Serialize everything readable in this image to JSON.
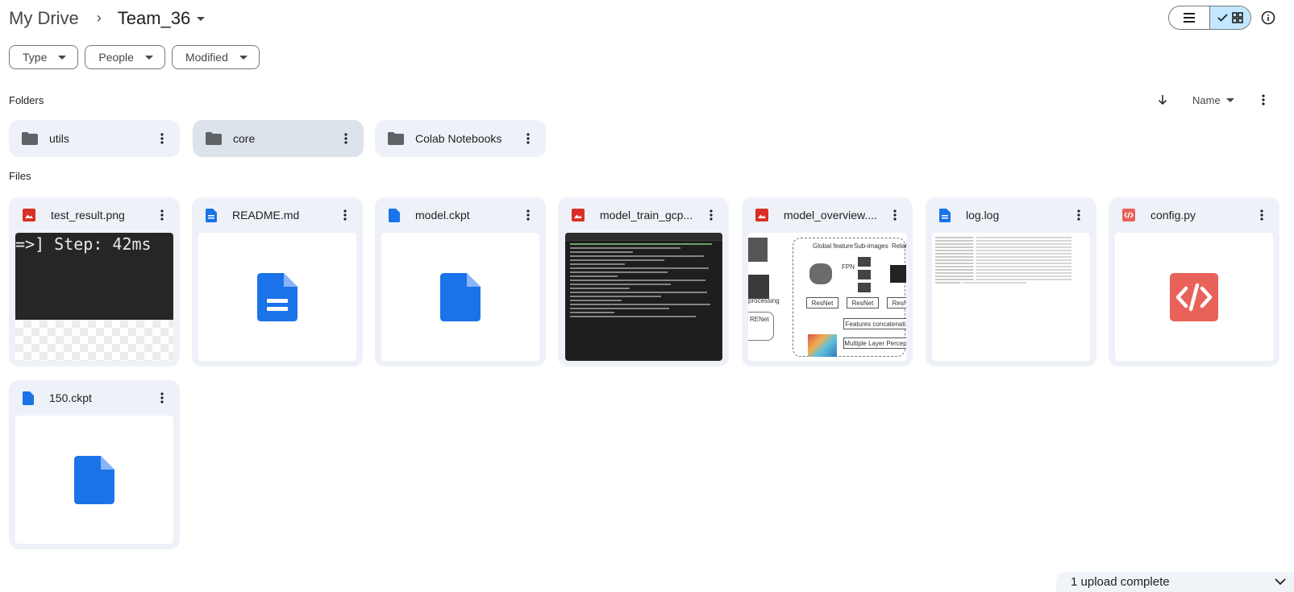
{
  "breadcrumb": {
    "root": "My Drive",
    "separator": "›",
    "current": "Team_36"
  },
  "view_toggle": {
    "list_icon": "list-icon",
    "grid_icon": "grid-icon",
    "active": "grid"
  },
  "filters": [
    {
      "label": "Type"
    },
    {
      "label": "People"
    },
    {
      "label": "Modified"
    }
  ],
  "folders_section": {
    "label": "Folders"
  },
  "files_section": {
    "label": "Files"
  },
  "sort": {
    "direction_icon": "arrow-down-icon",
    "field": "Name"
  },
  "folders": [
    {
      "name": "utils",
      "selected": false
    },
    {
      "name": "core",
      "selected": true
    },
    {
      "name": "Colab Notebooks",
      "selected": false
    }
  ],
  "files": [
    {
      "name": "test_result.png",
      "type": "image",
      "preview_text": "=>]  Step: 42ms"
    },
    {
      "name": "README.md",
      "type": "doc"
    },
    {
      "name": "model.ckpt",
      "type": "file"
    },
    {
      "name": "model_train_gcp...",
      "type": "image"
    },
    {
      "name": "model_overview....",
      "type": "image",
      "diagram_labels": [
        "Global feature",
        "Sub-images",
        "Relat feat",
        "FPN",
        "ResNet",
        "ResNet",
        "ResNet",
        "Res",
        "processing",
        "RENet",
        "Features concatenati",
        "Multiple Layer Percep"
      ]
    },
    {
      "name": "log.log",
      "type": "doc"
    },
    {
      "name": "config.py",
      "type": "code"
    },
    {
      "name": "150.ckpt",
      "type": "file"
    }
  ],
  "toast": {
    "message": "1 upload complete"
  },
  "colors": {
    "accent": "#c2e7ff",
    "doc_blue": "#1a73e8",
    "image_red": "#d93025",
    "code_red": "#e8625a",
    "folder_gray": "#5f6368"
  }
}
